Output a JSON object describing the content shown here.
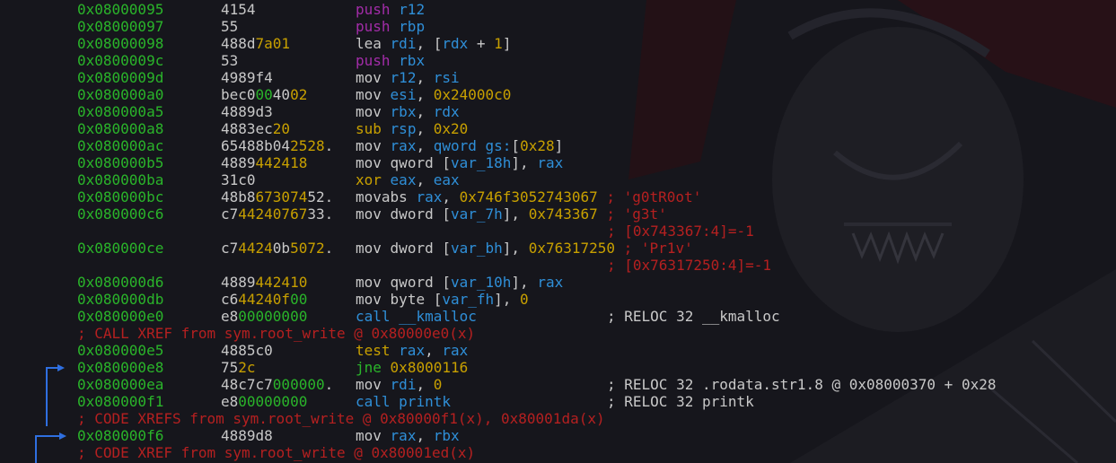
{
  "listing": [
    {
      "addr": "0x08000095",
      "bytes": "4154",
      "mn": "push",
      "ops": [
        [
          "reg",
          "r12"
        ]
      ]
    },
    {
      "addr": "0x08000097",
      "bytes": "55",
      "mn": "push",
      "ops": [
        [
          "reg",
          "rbp"
        ]
      ]
    },
    {
      "addr": "0x08000098",
      "bytes": "488d7a01",
      "mn": "lea",
      "ops": [
        [
          "reg",
          "rdi"
        ],
        [
          "txt",
          ", ["
        ],
        [
          "reg",
          "rdx"
        ],
        [
          "txt",
          " + "
        ],
        [
          "num",
          "1"
        ],
        [
          "txt",
          "]"
        ]
      ]
    },
    {
      "addr": "0x0800009c",
      "bytes": "53",
      "mn": "push",
      "ops": [
        [
          "reg",
          "rbx"
        ]
      ]
    },
    {
      "addr": "0x0800009d",
      "bytes": "4989f4",
      "mn": "mov",
      "ops": [
        [
          "reg",
          "r12"
        ],
        [
          "txt",
          ", "
        ],
        [
          "reg",
          "rsi"
        ]
      ]
    },
    {
      "addr": "0x080000a0",
      "bytes": "bec0004002",
      "mn": "mov",
      "ops": [
        [
          "reg",
          "esi"
        ],
        [
          "txt",
          ", "
        ],
        [
          "num",
          "0x24000c0"
        ]
      ]
    },
    {
      "addr": "0x080000a5",
      "bytes": "4889d3",
      "mn": "mov",
      "ops": [
        [
          "reg",
          "rbx"
        ],
        [
          "txt",
          ", "
        ],
        [
          "reg",
          "rdx"
        ]
      ]
    },
    {
      "addr": "0x080000a8",
      "bytes": "4883ec20",
      "mn": "sub",
      "ops": [
        [
          "reg",
          "rsp"
        ],
        [
          "txt",
          ", "
        ],
        [
          "num",
          "0x20"
        ]
      ]
    },
    {
      "addr": "0x080000ac",
      "bytes": "65488b042528.",
      "mn": "mov",
      "ops": [
        [
          "reg",
          "rax"
        ],
        [
          "txt",
          ", "
        ],
        [
          "reg",
          "qword gs:"
        ],
        [
          "txt",
          "["
        ],
        [
          "num",
          "0x28"
        ],
        [
          "txt",
          "]"
        ]
      ]
    },
    {
      "addr": "0x080000b5",
      "bytes": "4889442418",
      "mn": "mov",
      "ops": [
        [
          "txt",
          "qword ["
        ],
        [
          "reg",
          "var_18h"
        ],
        [
          "txt",
          "], "
        ],
        [
          "reg",
          "rax"
        ]
      ]
    },
    {
      "addr": "0x080000ba",
      "bytes": "31c0",
      "mn": "xor",
      "ops": [
        [
          "reg",
          "eax"
        ],
        [
          "txt",
          ", "
        ],
        [
          "reg",
          "eax"
        ]
      ]
    },
    {
      "addr": "0x080000bc",
      "bytes": "48b867307452.",
      "mn": "movabs",
      "ops": [
        [
          "reg",
          "rax"
        ],
        [
          "txt",
          ", "
        ],
        [
          "num",
          "0x746f3052743067"
        ],
        [
          "com",
          " ; 'g0tR0ot'"
        ]
      ]
    },
    {
      "addr": "0x080000c6",
      "bytes": "c74424076733.",
      "mn": "mov",
      "ops": [
        [
          "txt",
          "dword ["
        ],
        [
          "reg",
          "var_7h"
        ],
        [
          "txt",
          "], "
        ],
        [
          "num",
          "0x743367"
        ],
        [
          "com",
          " ; 'g3t'"
        ]
      ]
    },
    {
      "cont": "; [0x743367:4]=-1"
    },
    {
      "addr": "0x080000ce",
      "bytes": "c744240b5072.",
      "mn": "mov",
      "ops": [
        [
          "txt",
          "dword ["
        ],
        [
          "reg",
          "var_bh"
        ],
        [
          "txt",
          "], "
        ],
        [
          "num",
          "0x76317250"
        ],
        [
          "com",
          " ; 'Pr1v'"
        ]
      ]
    },
    {
      "cont": "; [0x76317250:4]=-1"
    },
    {
      "addr": "0x080000d6",
      "bytes": "4889442410",
      "mn": "mov",
      "ops": [
        [
          "txt",
          "qword ["
        ],
        [
          "reg",
          "var_10h"
        ],
        [
          "txt",
          "], "
        ],
        [
          "reg",
          "rax"
        ]
      ]
    },
    {
      "addr": "0x080000db",
      "bytes": "c644240f00",
      "mn": "mov",
      "ops": [
        [
          "txt",
          "byte ["
        ],
        [
          "reg",
          "var_fh"
        ],
        [
          "txt",
          "], "
        ],
        [
          "num",
          "0"
        ]
      ]
    },
    {
      "addr": "0x080000e0",
      "bytes": "e800000000",
      "mn": "call",
      "ops": [
        [
          "reg",
          "__kmalloc"
        ]
      ],
      "reloc": "; RELOC 32 __kmalloc"
    },
    {
      "xref": "; CALL XREF from sym.root_write @ 0x80000e0(x)"
    },
    {
      "addr": "0x080000e5",
      "bytes": "4885c0",
      "mn": "test",
      "ops": [
        [
          "reg",
          "rax"
        ],
        [
          "txt",
          ", "
        ],
        [
          "reg",
          "rax"
        ]
      ]
    },
    {
      "addr": "0x080000e8",
      "bytes": "752c",
      "mn": "jne",
      "ops": [
        [
          "num",
          "0x8000116"
        ]
      ],
      "arrow": "<"
    },
    {
      "addr": "0x080000ea",
      "bytes": "48c7c7000000.",
      "mn": "mov",
      "ops": [
        [
          "reg",
          "rdi"
        ],
        [
          "txt",
          ", "
        ],
        [
          "num",
          "0"
        ]
      ],
      "reloc": "; RELOC 32 .rodata.str1.8 @ 0x08000370 + 0x28"
    },
    {
      "addr": "0x080000f1",
      "bytes": "e800000000",
      "mn": "call",
      "ops": [
        [
          "reg",
          "printk"
        ]
      ],
      "reloc": "; RELOC 32 printk"
    },
    {
      "xref": "; CODE XREFS from sym.root_write @ 0x80000f1(x), 0x80001da(x)"
    },
    {
      "addr": "0x080000f6",
      "bytes": "4889d8",
      "mn": "mov",
      "ops": [
        [
          "reg",
          "rax"
        ],
        [
          "txt",
          ", "
        ],
        [
          "reg",
          "rbx"
        ]
      ],
      "arrow": ">"
    },
    {
      "xref": "; CODE XREF from sym.root_write @ 0x80001ed(x)"
    }
  ],
  "colors": {
    "bg": "#16161c",
    "addr": "#2ab52a",
    "reg": "#2f8fd8",
    "num": "#c8a000",
    "comment": "#b52020",
    "arrow": "#2f6fe0"
  }
}
